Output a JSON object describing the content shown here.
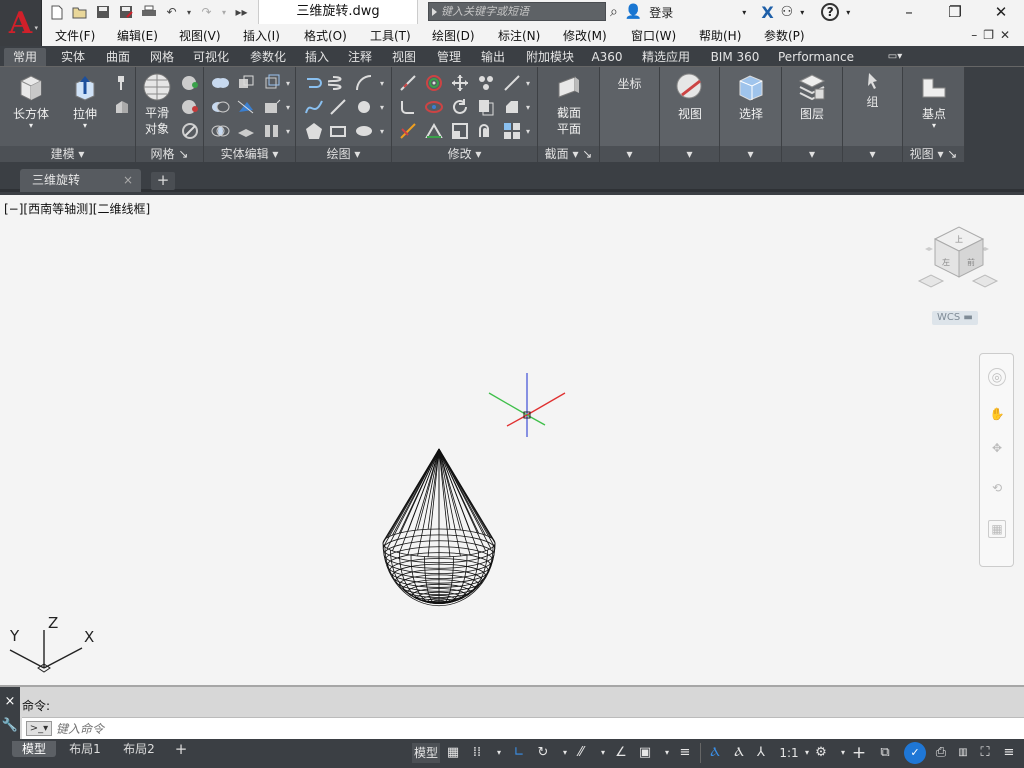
{
  "app": {
    "logo_letter": "A",
    "document_title": "三维旋转.dwg",
    "search_placeholder": "键入关键字或短语",
    "sign_in": "登录",
    "help_symbol": "?",
    "colors": {
      "logo_red": "#d0202a",
      "dark_bg": "#3b3f44",
      "ribbon_bg": "#575b60",
      "viewport_bg": "#f4f4f4",
      "active_blue": "#3a8fe8"
    }
  },
  "quick_access": [
    "new-icon",
    "open-icon",
    "save-icon",
    "save-as-icon",
    "print-icon",
    "undo-icon",
    "redo-icon",
    "more-icon"
  ],
  "menubar": [
    "文件(F)",
    "编辑(E)",
    "视图(V)",
    "插入(I)",
    "格式(O)",
    "工具(T)",
    "绘图(D)",
    "标注(N)",
    "修改(M)",
    "窗口(W)",
    "帮助(H)",
    "参数(P)"
  ],
  "ribbon_tabs": [
    "常用",
    "实体",
    "曲面",
    "网格",
    "可视化",
    "参数化",
    "插入",
    "注释",
    "视图",
    "管理",
    "输出",
    "附加模块",
    "A360",
    "精选应用",
    "BIM 360",
    "Performance"
  ],
  "ribbon_active_tab": "常用",
  "ribbon_panels": {
    "modeling": {
      "title": "建模",
      "box": "长方体",
      "extrude": "拉伸"
    },
    "mesh": {
      "title": "网格",
      "smooth": "平滑\n对象"
    },
    "solid_edit": {
      "title": "实体编辑"
    },
    "draw": {
      "title": "绘图"
    },
    "modify": {
      "title": "修改"
    },
    "section": {
      "title": "截面",
      "plane": "截面\n平面"
    },
    "coordinates": {
      "label": "坐标"
    },
    "view_panel": {
      "label": "视图"
    },
    "selection": {
      "label": "选择"
    },
    "layers": {
      "label": "图层"
    },
    "groups": {
      "label": "组"
    },
    "base": {
      "title": "视图",
      "base": "基点"
    }
  },
  "doc_tabs": {
    "active": "三维旋转",
    "close": "×",
    "new": "+"
  },
  "viewport": {
    "label": "[−][西南等轴测][二维线框]",
    "wcs": "WCS",
    "viewcube_faces": {
      "top": "上",
      "left": "左",
      "front": "前"
    },
    "ucs_axes": {
      "x": "X",
      "y": "Y",
      "z": "Z"
    }
  },
  "command": {
    "history": "命令:",
    "placeholder": "键入命令",
    "close": "×"
  },
  "layout_tabs": [
    "模型",
    "布局1",
    "布局2"
  ],
  "layout_add": "+",
  "status_bar": {
    "model": "模型",
    "scale": "1:1"
  }
}
